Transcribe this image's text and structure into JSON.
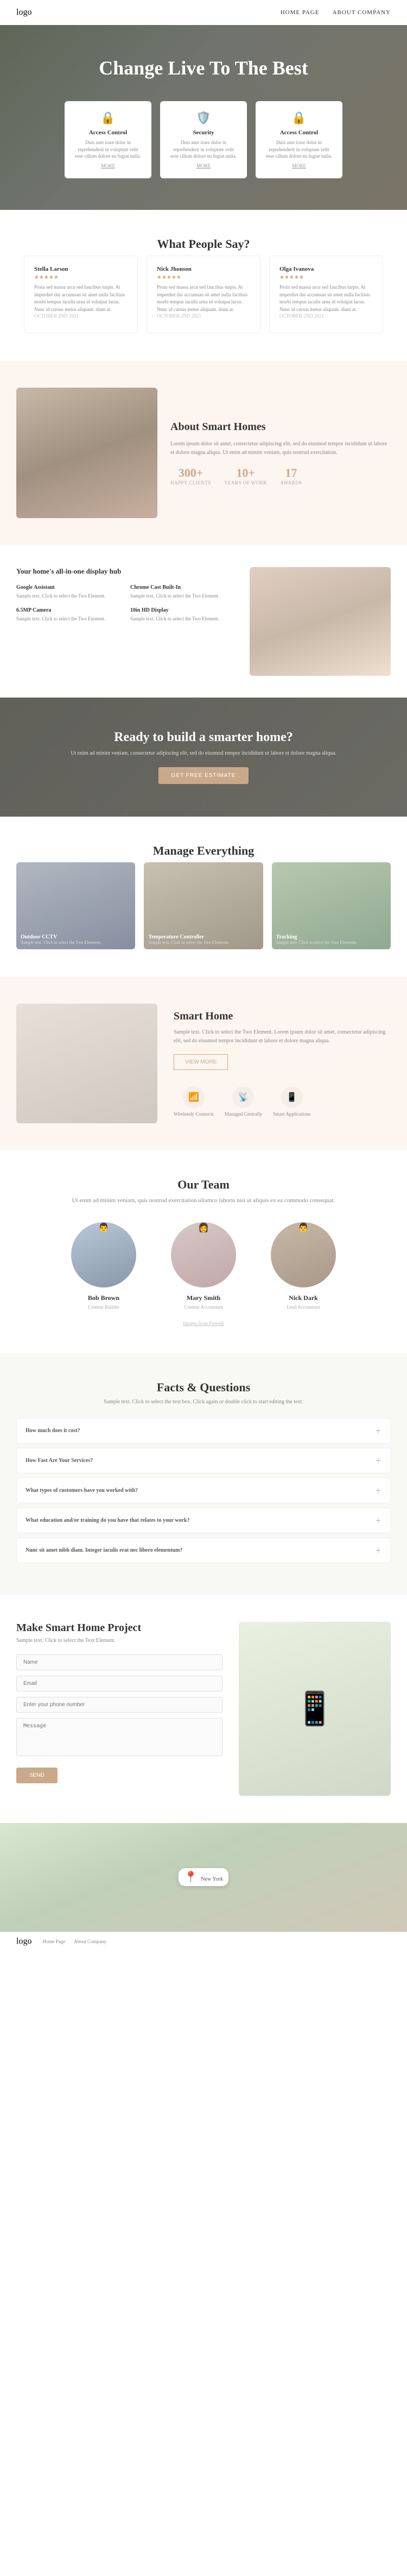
{
  "nav": {
    "logo": "logo",
    "links": [
      "Home Page",
      "About Company"
    ]
  },
  "hero": {
    "title": "Change Live To The Best",
    "cards": [
      {
        "icon": "🔒",
        "title": "Access Control",
        "text": "Duis aute irure dolor in reprehenderit in voluptate velit esse cillum dolore eu fugiat nulla.",
        "more": "MORE"
      },
      {
        "icon": "🛡️",
        "title": "Security",
        "text": "Duis aute irure dolor in reprehenderit in voluptate velit esse cillum dolore eu fugiat nulla.",
        "more": "MORE"
      },
      {
        "icon": "🔒",
        "title": "Access Control",
        "text": "Duis aute irure dolor in reprehenderit in voluptate velit esse cillum dolore eu fugiat nulla.",
        "more": "MORE"
      }
    ]
  },
  "testimonials": {
    "title": "What People Say?",
    "items": [
      {
        "name": "Stella Larson",
        "date": "OCTOBER 2ND 2021",
        "stars": "★★★★★",
        "text": "Proin sed massa arcu sed faucibus turpis. At imperdiet dui accumsan sit amet nulla facilisis morbi tempus iaculis urna id volutpat lacus. Nunc id cursus metus aliquam. diam at."
      },
      {
        "name": "Nick Jhonson",
        "date": "OCTOBER 2ND 2021",
        "stars": "★★★★★",
        "text": "Proin sed massa arcu sed faucibus turpis. At imperdiet dui accumsan sit amet nulla facilisis morbi tempus iaculis urna id volutpat lacus. Nunc id cursus metus aliquam. diam at."
      },
      {
        "name": "Olga Ivanova",
        "date": "OCTOBER 2ND 2021",
        "stars": "★★★★★",
        "text": "Proin sed massa arcu sed faucibus turpis. At imperdiet dui accumsan sit amet nulla facilisis morbi tempus iaculis urna id volutpat lacus. Nunc id cursus metus aliquam. diam at."
      }
    ]
  },
  "about": {
    "title": "About Smart Homes",
    "text": "Lorem ipsum dolor sit amet, consectetur adipiscing elit, sed do eiusmod tempor incididunt ut labore et dolore magna aliqua. Ut enim ad minim veniam, quis nostrud exercitation.",
    "stats": [
      {
        "num": "300+",
        "label": "HAPPY CLIENTS"
      },
      {
        "num": "10+",
        "label": "YEARS OF WORK"
      },
      {
        "num": "17",
        "label": "AWARDS"
      }
    ]
  },
  "hub": {
    "title": "Your home's all-in-one display hub",
    "features": [
      {
        "title": "Google Assistant",
        "text": "Sample text. Click to select the Two Element."
      },
      {
        "title": "Chrome Cast Built-In",
        "text": "Sample text. Click to select the Two Element."
      },
      {
        "title": "6.5MP Camera",
        "text": "Sample text. Click to select the Two Element."
      },
      {
        "title": "10in HD Display",
        "text": "Sample text. Click to select the Two Element."
      }
    ]
  },
  "cta": {
    "title": "Ready to build a smarter home?",
    "text": "Ut enim ad minim veniam, consectetur adipiscing elit, sed do eiusmod tempor incididunt ut labore et dolore magna aliqua.",
    "button": "GET FREE ESTIMATE"
  },
  "manage": {
    "title": "Manage Everything",
    "cards": [
      {
        "title": "Outdoor CCTV",
        "text": "Sample text. Click to select the Two Elements."
      },
      {
        "title": "Temperature Controller",
        "text": "Sample text. Click to select the Two Elements."
      },
      {
        "title": "Tracking",
        "text": "Sample text. Click to select the Two Elements."
      }
    ]
  },
  "smart": {
    "title": "Smart Home",
    "text": "Sample text. Click to select the Two Element. Lorem ipsum dolor sit amet, consectetur adipiscing elit, sed do eiusmod tempor incididunt ut labore et dolore magna aliqua.",
    "button": "VIEW MORE",
    "icons": [
      {
        "icon": "📶",
        "label": "Wirelessly Connects"
      },
      {
        "icon": "📡",
        "label": "Managed Centrally"
      },
      {
        "icon": "📱",
        "label": "Smart Applications"
      }
    ]
  },
  "team": {
    "title": "Our Team",
    "sub": "Ut enim ad minim veniam, quis nostrud exercitation ullamco laboris nisi ut aliquis ex ea commodo consequat.",
    "members": [
      {
        "name": "Bob Brown",
        "role": "Content Builder",
        "gender": "male"
      },
      {
        "name": "Mary Smith",
        "role": "Content Accountant",
        "gender": "female"
      },
      {
        "name": "Nick Dark",
        "role": "Lead Accountant",
        "gender": "male2"
      }
    ],
    "credit": "Images from Freepik"
  },
  "faq": {
    "title": "Facts & Questions",
    "sub": "Sample text. Click to select the text box. Click again or double click to start editing the text.",
    "items": [
      "How much does it cost?",
      "How Fast Are Your Services?",
      "What types of customers have you worked with?",
      "What education and/or training do you have that relates to your work?",
      "Nunc sit amet nibh diam. Integer iaculis erat nec libero elementum?"
    ]
  },
  "contact": {
    "title": "Make Smart Home Project",
    "sub": "Sample text. Click to select the Text Element.",
    "fields": {
      "name_placeholder": "Name",
      "email_placeholder": "Email",
      "phone_placeholder": "Enter your phone number",
      "message_placeholder": "Message"
    },
    "button": "SEND"
  },
  "map": {
    "label": "New York"
  },
  "footer_nav": {
    "logo": "logo",
    "links": [
      "Home Page",
      "About Company"
    ]
  }
}
